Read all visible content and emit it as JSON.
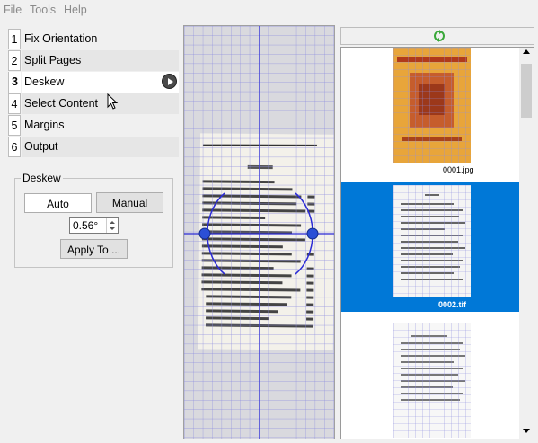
{
  "menu": [
    "File",
    "Tools",
    "Help"
  ],
  "stages": [
    {
      "num": "1",
      "label": "Fix Orientation"
    },
    {
      "num": "2",
      "label": "Split Pages"
    },
    {
      "num": "3",
      "label": "Deskew"
    },
    {
      "num": "4",
      "label": "Select Content"
    },
    {
      "num": "5",
      "label": "Margins"
    },
    {
      "num": "6",
      "label": "Output"
    }
  ],
  "deskew": {
    "title": "Deskew",
    "auto_label": "Auto",
    "manual_label": "Manual",
    "angle": "0.56°",
    "apply_label": "Apply To ..."
  },
  "thumbnails": [
    {
      "name": "0001.jpg",
      "selected": false
    },
    {
      "name": "0002.tif",
      "selected": true
    },
    {
      "name": "",
      "selected": false
    }
  ],
  "colors": {
    "selection": "#0078d7",
    "grid": "#2b2bd6",
    "cover": "#e8a53a"
  }
}
